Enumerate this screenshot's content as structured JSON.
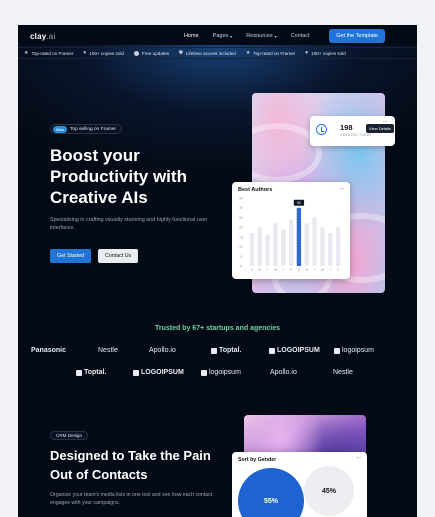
{
  "nav": {
    "logo": "clay",
    "logo_suffix": ".ai",
    "links": [
      {
        "label": "Home",
        "active": true,
        "dropdown": false
      },
      {
        "label": "Pages",
        "active": false,
        "dropdown": true
      },
      {
        "label": "Resources",
        "active": false,
        "dropdown": true
      },
      {
        "label": "Contact",
        "active": false,
        "dropdown": false
      }
    ],
    "cta": "Get the Template"
  },
  "ticker": [
    {
      "icon": "star-icon",
      "text": "Top-rated on Framer"
    },
    {
      "icon": "heart-icon",
      "text": "100+ copies sold"
    },
    {
      "icon": "update-icon",
      "text": "Free updates"
    },
    {
      "icon": "shield-icon",
      "text": "Lifetime access included"
    },
    {
      "icon": "star-icon",
      "text": "Top-rated on Framer"
    },
    {
      "icon": "heart-icon",
      "text": "100+ copies sold"
    }
  ],
  "hero": {
    "badge_pill": "New",
    "badge_text": "Top selling on Framer",
    "title": "Boost your Productivity with Creative AIs",
    "subtitle": "Specialising in crafting visually stunning and highly functional user interfaces.",
    "primary_button": "Get Started",
    "secondary_button": "Contact Us"
  },
  "stat_card": {
    "value": "198",
    "label": "CREATED TODAY",
    "tooltip": "View Details",
    "menu": "..."
  },
  "chart_data": {
    "type": "bar",
    "title": "Best Authors",
    "categories": [
      "S",
      "M",
      "T",
      "W",
      "T",
      "F",
      "S",
      "M",
      "T",
      "W",
      "T",
      "F"
    ],
    "values": [
      17,
      20,
      16,
      22,
      19,
      24,
      30,
      22,
      25,
      20,
      17,
      20
    ],
    "highlight_index": 6,
    "highlight_label": "50",
    "ylim": [
      0,
      35
    ],
    "yticks": [
      "35",
      "30",
      "25",
      "20",
      "15",
      "10",
      "5",
      "0"
    ],
    "colors": {
      "bar": "#e7eaee",
      "highlight": "#2563c9"
    }
  },
  "chart_menu": "...",
  "trusted": {
    "heading": "Trusted by 67+ startups and agencies",
    "row1": [
      "Panasonic",
      "Nestle",
      "Apollo.io",
      "Toptal.",
      "LOGOIPSUM",
      "logoipsum"
    ],
    "row2": [
      "Toptal.",
      "LOGOIPSUM",
      "logoipsum",
      "Apollo.io",
      "Nestle"
    ]
  },
  "crm": {
    "badge": "CRM Design",
    "title": "Designed to Take the Pain Out of Contacts",
    "subtitle": "Organize your team's media lists in one tool and see how each contact engages with your campaigns.",
    "card_title": "Sort by Gender",
    "card_menu": "...",
    "male_pct": "55%",
    "female_pct": "45%"
  },
  "colors": {
    "accent": "#1f74d6",
    "background": "#050b16",
    "trusted": "#6fd1a8"
  }
}
